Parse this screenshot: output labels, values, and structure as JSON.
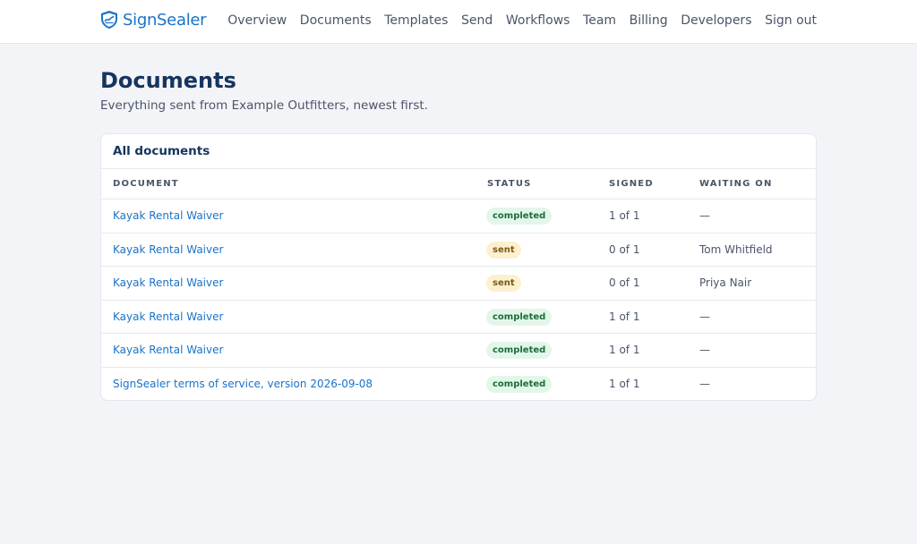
{
  "brand": {
    "name": "SignSealer",
    "color": "#1a73c8"
  },
  "nav": [
    {
      "label": "Overview",
      "key": "overview"
    },
    {
      "label": "Documents",
      "key": "documents"
    },
    {
      "label": "Templates",
      "key": "templates"
    },
    {
      "label": "Send",
      "key": "send"
    },
    {
      "label": "Workflows",
      "key": "workflows"
    },
    {
      "label": "Team",
      "key": "team"
    },
    {
      "label": "Billing",
      "key": "billing"
    },
    {
      "label": "Developers",
      "key": "developers"
    },
    {
      "label": "Sign out",
      "key": "sign-out"
    }
  ],
  "page": {
    "title": "Documents",
    "subtitle": "Everything sent from Example Outfitters, newest first."
  },
  "card": {
    "title": "All documents",
    "columns": {
      "document": "DOCUMENT",
      "status": "STATUS",
      "signed": "SIGNED",
      "waiting": "WAITING ON"
    },
    "rows": [
      {
        "document": "Kayak Rental Waiver",
        "status": "completed",
        "signed": "1 of 1",
        "waiting": "—"
      },
      {
        "document": "Kayak Rental Waiver",
        "status": "sent",
        "signed": "0 of 1",
        "waiting": "Tom Whitfield"
      },
      {
        "document": "Kayak Rental Waiver",
        "status": "sent",
        "signed": "0 of 1",
        "waiting": "Priya Nair"
      },
      {
        "document": "Kayak Rental Waiver",
        "status": "completed",
        "signed": "1 of 1",
        "waiting": "—"
      },
      {
        "document": "Kayak Rental Waiver",
        "status": "completed",
        "signed": "1 of 1",
        "waiting": "—"
      },
      {
        "document": "SignSealer terms of service, version 2026-09-08",
        "status": "completed",
        "signed": "1 of 1",
        "waiting": "—"
      }
    ]
  },
  "colors": {
    "completed_bg": "#e3f6ea",
    "sent_bg": "#fdf0cf",
    "title": "#15355e",
    "link": "#1a73c8"
  }
}
